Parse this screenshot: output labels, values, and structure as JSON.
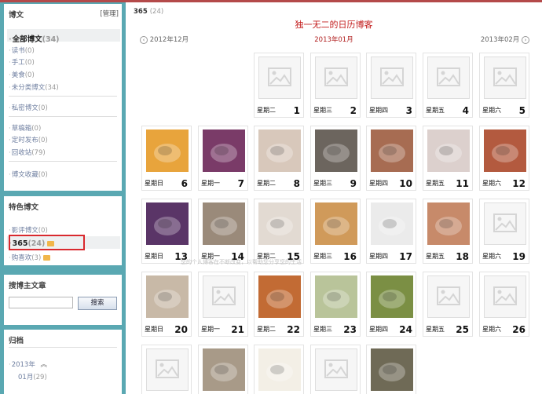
{
  "sidebar": {
    "posts": {
      "title": "博文",
      "manage": "[管理]",
      "items": [
        {
          "label": "全部博文",
          "count": "(34)",
          "bold": true
        },
        {
          "label": "读书",
          "count": "(0)"
        },
        {
          "label": "手工",
          "count": "(0)"
        },
        {
          "label": "美食",
          "count": "(0)"
        },
        {
          "label": "未分类博文",
          "count": "(34)"
        },
        {
          "label": "私密博文",
          "count": "(0)"
        },
        {
          "label": "草稿箱",
          "count": "(0)"
        },
        {
          "label": "定时发布",
          "count": "(0)"
        },
        {
          "label": "回收站",
          "count": "(79)"
        },
        {
          "label": "博文收藏",
          "count": "(0)"
        }
      ]
    },
    "featured": {
      "title": "特色博文",
      "items": [
        {
          "label": "影评博文",
          "count": "(0)"
        },
        {
          "label": "365",
          "count": "(24)",
          "bold": true
        },
        {
          "label": "购喜欢",
          "count": "(3)"
        }
      ]
    },
    "search": {
      "title": "搜博主文章",
      "value": "",
      "button": "搜索"
    },
    "archive": {
      "title": "归档",
      "year": "2013年",
      "month": "01月",
      "month_count": "(29)"
    }
  },
  "main": {
    "title": "365",
    "title_count": "(24)",
    "blog_title": "独一无二的日历博客",
    "nav": {
      "prev": "2012年12月",
      "current": "2013年01月",
      "next": "2013年02月"
    },
    "watermark": "您的个人博客在不断改变，以帮助您分享您的生活"
  },
  "calendar": [
    {
      "weekday": "星期二",
      "day": "1",
      "has_photo": false
    },
    {
      "weekday": "星期三",
      "day": "2",
      "has_photo": false
    },
    {
      "weekday": "星期四",
      "day": "3",
      "has_photo": false
    },
    {
      "weekday": "星期五",
      "day": "4",
      "has_photo": false
    },
    {
      "weekday": "星期六",
      "day": "5",
      "has_photo": false
    },
    {
      "weekday": "星期日",
      "day": "6",
      "has_photo": true,
      "color": "#e8a43c"
    },
    {
      "weekday": "星期一",
      "day": "7",
      "has_photo": true,
      "color": "#7a3b68"
    },
    {
      "weekday": "星期二",
      "day": "8",
      "has_photo": true,
      "color": "#d8c8bb"
    },
    {
      "weekday": "星期三",
      "day": "9",
      "has_photo": true,
      "color": "#6c655e"
    },
    {
      "weekday": "星期四",
      "day": "10",
      "has_photo": true,
      "color": "#a76c52"
    },
    {
      "weekday": "星期五",
      "day": "11",
      "has_photo": true,
      "color": "#dcd0cd"
    },
    {
      "weekday": "星期六",
      "day": "12",
      "has_photo": true,
      "color": "#b35a3f"
    },
    {
      "weekday": "星期日",
      "day": "13",
      "has_photo": true,
      "color": "#5a3567"
    },
    {
      "weekday": "星期一",
      "day": "14",
      "has_photo": true,
      "color": "#9a8a7a"
    },
    {
      "weekday": "星期二",
      "day": "15",
      "has_photo": true,
      "color": "#e2dad2"
    },
    {
      "weekday": "星期三",
      "day": "16",
      "has_photo": true,
      "color": "#d09a5a"
    },
    {
      "weekday": "星期四",
      "day": "17",
      "has_photo": true,
      "color": "#ebebeb"
    },
    {
      "weekday": "星期五",
      "day": "18",
      "has_photo": true,
      "color": "#c78a6a"
    },
    {
      "weekday": "星期六",
      "day": "19",
      "has_photo": false
    },
    {
      "weekday": "星期日",
      "day": "20",
      "has_photo": true,
      "color": "#c8b9a7"
    },
    {
      "weekday": "星期一",
      "day": "21",
      "has_photo": false
    },
    {
      "weekday": "星期二",
      "day": "22",
      "has_photo": true,
      "color": "#c26b34"
    },
    {
      "weekday": "星期三",
      "day": "23",
      "has_photo": true,
      "color": "#b9c49a"
    },
    {
      "weekday": "星期四",
      "day": "24",
      "has_photo": true,
      "color": "#7b8f44"
    },
    {
      "weekday": "星期五",
      "day": "25",
      "has_photo": false
    },
    {
      "weekday": "星期六",
      "day": "26",
      "has_photo": false
    },
    {
      "weekday": "",
      "day": "",
      "has_photo": false
    },
    {
      "weekday": "",
      "day": "",
      "has_photo": true,
      "color": "#a89a88"
    },
    {
      "weekday": "",
      "day": "",
      "has_photo": true,
      "color": "#f3efe6"
    },
    {
      "weekday": "",
      "day": "",
      "has_photo": false
    },
    {
      "weekday": "",
      "day": "",
      "has_photo": true,
      "color": "#6f6a56"
    }
  ]
}
